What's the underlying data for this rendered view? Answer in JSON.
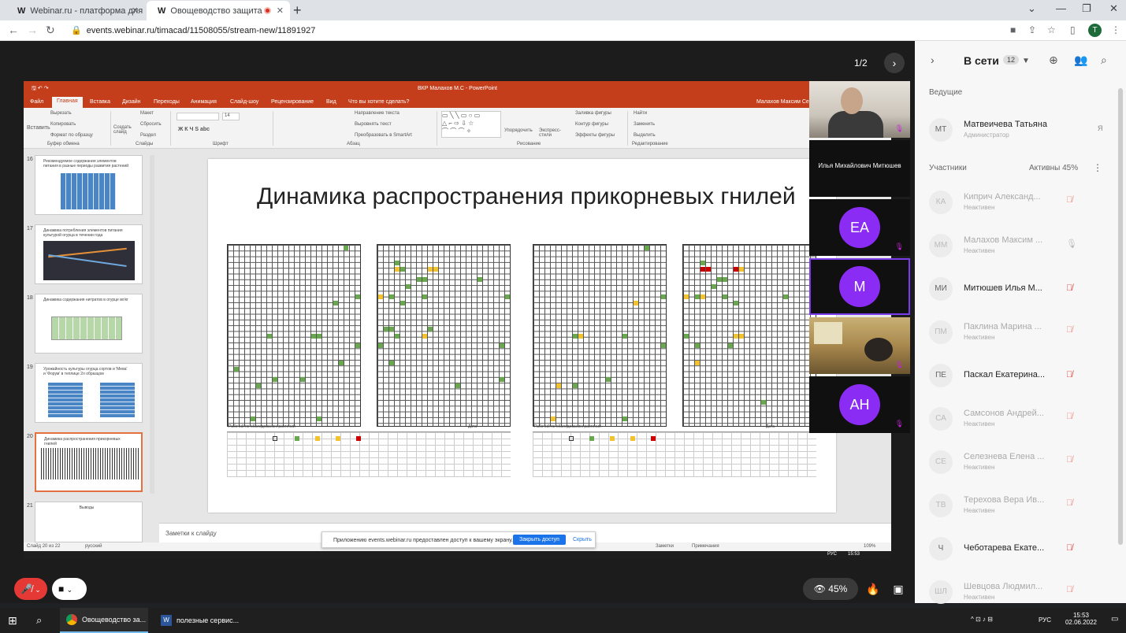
{
  "browser": {
    "tabs": [
      {
        "icon": "W",
        "label": "Webinar.ru - платформа для пр..."
      },
      {
        "icon": "W",
        "label": "Овощеводство защита итог..."
      }
    ],
    "url": "events.webinar.ru/timacad/11508055/stream-new/11891927",
    "profile_initial": "T"
  },
  "stage": {
    "page_indicator": "1/2"
  },
  "ppt": {
    "window_title": "ВКР Малахов М.С - PowerPoint",
    "user": "Малахов Максим Се...",
    "menu": [
      "Файл",
      "Главная",
      "Вставка",
      "Дизайн",
      "Переходы",
      "Анимация",
      "Слайд-шоу",
      "Рецензирование",
      "Вид",
      "Что вы хотите сделать?"
    ],
    "ribbon_groups": [
      "Буфер обмена",
      "Слайды",
      "Шрифт",
      "Абзац",
      "Рисование",
      "Редактирование"
    ],
    "ribbon_items": {
      "insert": "Вставить",
      "cut": "Вырезать",
      "copy": "Копировать",
      "format": "Формат по образцу",
      "create_slide": "Создать слайд",
      "layout": "Макет",
      "reset": "Сбросить",
      "section": "Раздел",
      "font_size": "14",
      "text_dir": "Направление текста",
      "align_text": "Выровнять текст",
      "smartart": "Преобразовать в SmartArt",
      "arrange": "Упорядочить",
      "quick_styles": "Экспресс-стили",
      "fill": "Заливка фигуры",
      "outline": "Контур фигуры",
      "effects": "Эффекты фигуры",
      "find": "Найти",
      "replace": "Заменить",
      "select": "Выделить"
    },
    "thumbs": [
      {
        "num": "16",
        "title": "Рекомендуемое содержания элементов питания в разные периоды развития растений"
      },
      {
        "num": "17",
        "title": "Динамика потребления элементов питания культурой огурца в течении года"
      },
      {
        "num": "18",
        "title": "Динамика содержания нитратов в огурце мг/кг"
      },
      {
        "num": "19",
        "title": "Урожайность культуры огурца сортов и 'Мева' и 'Форум' в теплице 2л образцом"
      },
      {
        "num": "20",
        "title": "Динамика распространения прикорневых гнилей"
      },
      {
        "num": "21",
        "title": "Выводы"
      }
    ],
    "slide_title": "Динамика распространения прикорневых гнилей",
    "table_label_left": "Рабочий по обследованию растений",
    "table_label_date": "Дата",
    "notes_placeholder": "Заметки к слайду",
    "status_left": "Слайд 20 из 22",
    "status_lang": "русский",
    "status_notes": "Заметки",
    "status_comments": "Примечания",
    "zoom": "109%"
  },
  "share_bar": {
    "message": "Приложению events.webinar.ru предоставлен доступ к вашему экрану.",
    "close_access": "Закрыть доступ",
    "hide": "Скрыть"
  },
  "inner_taskbar": {
    "lang": "РУС",
    "time": "15:53",
    "date": "02.06.2022"
  },
  "videos": [
    {
      "type": "camera",
      "name": ""
    },
    {
      "type": "name",
      "name": "Илья Михайлович Митюшев"
    },
    {
      "type": "avatar",
      "initials": "ЕА"
    },
    {
      "type": "avatar",
      "initials": "М",
      "speaking": true
    },
    {
      "type": "camera",
      "name": ""
    },
    {
      "type": "avatar",
      "initials": "АН"
    }
  ],
  "controls": {
    "viewers_percent": "45%"
  },
  "sidebar": {
    "title": "В сети",
    "count": "12",
    "host_section": "Ведущие",
    "host": {
      "initials": "МТ",
      "name": "Матвеичева Татьяна",
      "role": "Администратор",
      "flag": "Я"
    },
    "participants_section": "Участники",
    "active_label": "Активны 45%",
    "participants": [
      {
        "initials": "КА",
        "name": "Киприч Александ...",
        "status": "Неактивен",
        "online": false,
        "mic": "muted"
      },
      {
        "initials": "ММ",
        "name": "Малахов Максим ...",
        "status": "Неактивен",
        "online": false,
        "mic": "on"
      },
      {
        "initials": "МИ",
        "name": "Митюшев Илья М...",
        "status": "",
        "online": true,
        "mic": "muted"
      },
      {
        "initials": "ПМ",
        "name": "Паклина Марина ...",
        "status": "Неактивен",
        "online": false,
        "mic": "muted"
      },
      {
        "initials": "ПЕ",
        "name": "Паскал Екатерина...",
        "status": "",
        "online": true,
        "mic": "muted"
      },
      {
        "initials": "СА",
        "name": "Самсонов Андрей...",
        "status": "Неактивен",
        "online": false,
        "mic": "muted"
      },
      {
        "initials": "СЕ",
        "name": "Селезнева Елена ...",
        "status": "Неактивен",
        "online": false,
        "mic": "muted"
      },
      {
        "initials": "ТВ",
        "name": "Терехова Вера Ив...",
        "status": "Неактивен",
        "online": false,
        "mic": "muted"
      },
      {
        "initials": "Ч",
        "name": "Чеботарева Екате...",
        "status": "",
        "online": true,
        "mic": "muted"
      },
      {
        "initials": "ШЛ",
        "name": "Шевцова Людмил...",
        "status": "Неактивен",
        "online": false,
        "mic": "muted"
      }
    ]
  },
  "taskbar": {
    "items": [
      {
        "label": "Овощеводство за..."
      },
      {
        "label": "полезные сервис..."
      }
    ],
    "lang": "РУС",
    "time": "15:53",
    "date": "02.06.2022"
  }
}
